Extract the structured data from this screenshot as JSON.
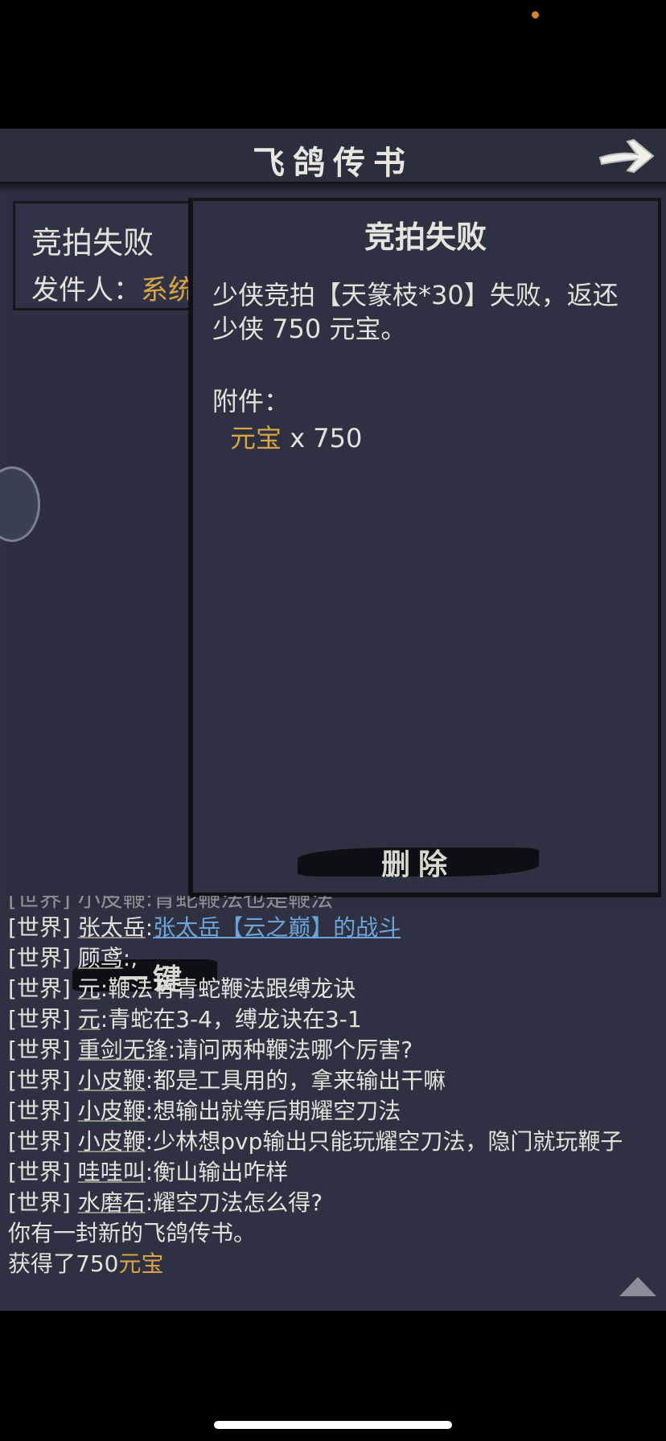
{
  "window": {
    "title": "飞鸽传书"
  },
  "mail_list": {
    "items": [
      {
        "subject": "竞拍失败",
        "sender_label": "发件人：",
        "sender_name": "系统"
      }
    ],
    "bulk_button_label": "一键"
  },
  "mail_detail": {
    "title": "竞拍失败",
    "body": "少侠竞拍【天篆枝*30】失败，返还少侠 750 元宝。",
    "attachments_label": "附件：",
    "attachment": {
      "name": "元宝",
      "qty": " x 750"
    },
    "delete_label": "删除"
  },
  "chat": {
    "partial_first": "[世界] 小皮鞭:青蛇鞭法也是鞭法",
    "messages": [
      {
        "channel": "[世界]",
        "sender": "张太岳",
        "sep": ":",
        "link": "张太岳【云之巅】的战斗"
      },
      {
        "channel": "[世界]",
        "sender": "顾鸢",
        "sep": ":",
        "text": ","
      },
      {
        "channel": "[世界]",
        "sender": "元",
        "sep": ":",
        "text": "鞭法有青蛇鞭法跟缚龙诀"
      },
      {
        "channel": "[世界]",
        "sender": "元",
        "sep": ":",
        "text": "青蛇在3-4，缚龙诀在3-1"
      },
      {
        "channel": "[世界]",
        "sender": "重剑无锋",
        "sep": ":",
        "text": "请问两种鞭法哪个厉害?"
      },
      {
        "channel": "[世界]",
        "sender": "小皮鞭",
        "sep": ":",
        "text": "都是工具用的，拿来输出干嘛"
      },
      {
        "channel": "[世界]",
        "sender": "小皮鞭",
        "sep": ":",
        "text": "想输出就等后期耀空刀法"
      },
      {
        "channel": "[世界]",
        "sender": "小皮鞭",
        "sep": ":",
        "text": "少林想pvp输出只能玩耀空刀法，隐门就玩鞭子"
      },
      {
        "channel": "[世界]",
        "sender": "哇哇叫",
        "sep": ":",
        "text": "衡山输出咋样"
      },
      {
        "channel": "[世界]",
        "sender": "水磨石",
        "sep": ":",
        "text": "耀空刀法怎么得?"
      }
    ],
    "system_new_mail": "你有一封新的飞鸽传书。",
    "gain_prefix": "获得了750",
    "gain_item": "元宝"
  },
  "icons": {
    "back": "arrow-right-icon",
    "collapse": "triangle-up-icon",
    "badge": "round-badge-icon"
  },
  "colors": {
    "background": "#2d3142",
    "gold": "#d9a445",
    "link": "#6fa3d8",
    "text": "#e3e1db"
  }
}
